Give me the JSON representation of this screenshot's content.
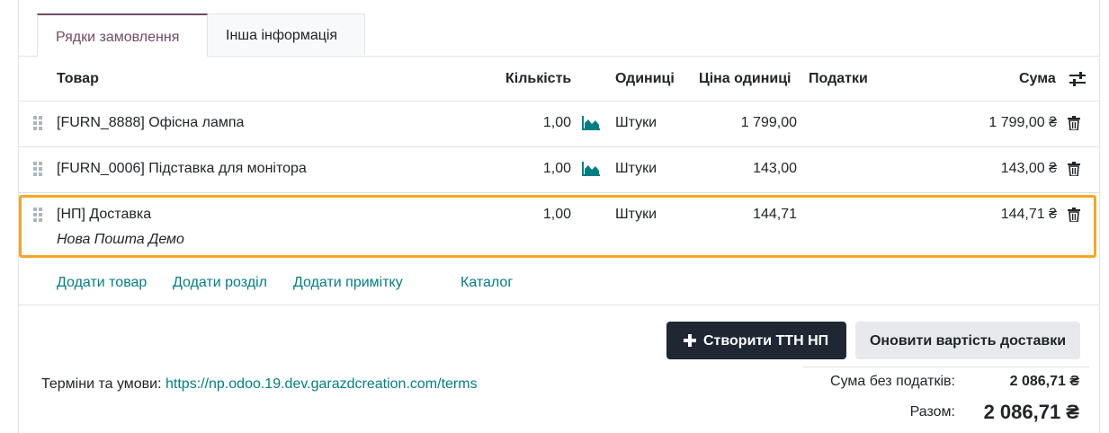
{
  "tabs": [
    {
      "label": "Рядки замовлення",
      "active": true
    },
    {
      "label": "Інша інформація",
      "active": false
    }
  ],
  "columns": {
    "product": "Товар",
    "quantity": "Кількість",
    "uom": "Одиниці",
    "price_unit": "Ціна одиниці",
    "taxes": "Податки",
    "subtotal": "Сума",
    "settings_icon": "sliders-icon"
  },
  "lines": [
    {
      "product": "[FURN_8888] Офісна лампа",
      "quantity": "1,00",
      "forecast_icon": "area-chart-icon",
      "uom": "Штуки",
      "price_unit": "1 799,00",
      "taxes": "",
      "subtotal": "1 799,00 ₴"
    },
    {
      "product": "[FURN_0006] Підставка для монітора",
      "quantity": "1,00",
      "forecast_icon": "area-chart-icon",
      "uom": "Штуки",
      "price_unit": "143,00",
      "taxes": "",
      "subtotal": "143,00 ₴"
    },
    {
      "product": "[НП] Доставка",
      "description": "Нова Пошта Демо",
      "quantity": "1,00",
      "uom": "Штуки",
      "price_unit": "144,71",
      "taxes": "",
      "subtotal": "144,71 ₴",
      "highlighted": true,
      "highlight_color": "#f5a623"
    }
  ],
  "add_links": {
    "add_product": "Додати товар",
    "add_section": "Додати розділ",
    "add_note": "Додати примітку",
    "catalog": "Каталог"
  },
  "actions": {
    "create_ttn": "Створити ТТН НП",
    "update_shipping": "Оновити вартість доставки"
  },
  "terms": {
    "label": "Терміни та умови:",
    "url": "https://np.odoo.19.dev.garazdcreation.com/terms"
  },
  "totals": {
    "untaxed_label": "Сума без податків:",
    "untaxed_value": "2 086,71 ₴",
    "total_label": "Разом:",
    "total_value": "2 086,71 ₴"
  },
  "colors": {
    "accent": "#714b67",
    "link": "#017e84",
    "primary_button": "#1f2733",
    "highlight": "#f5a623"
  }
}
